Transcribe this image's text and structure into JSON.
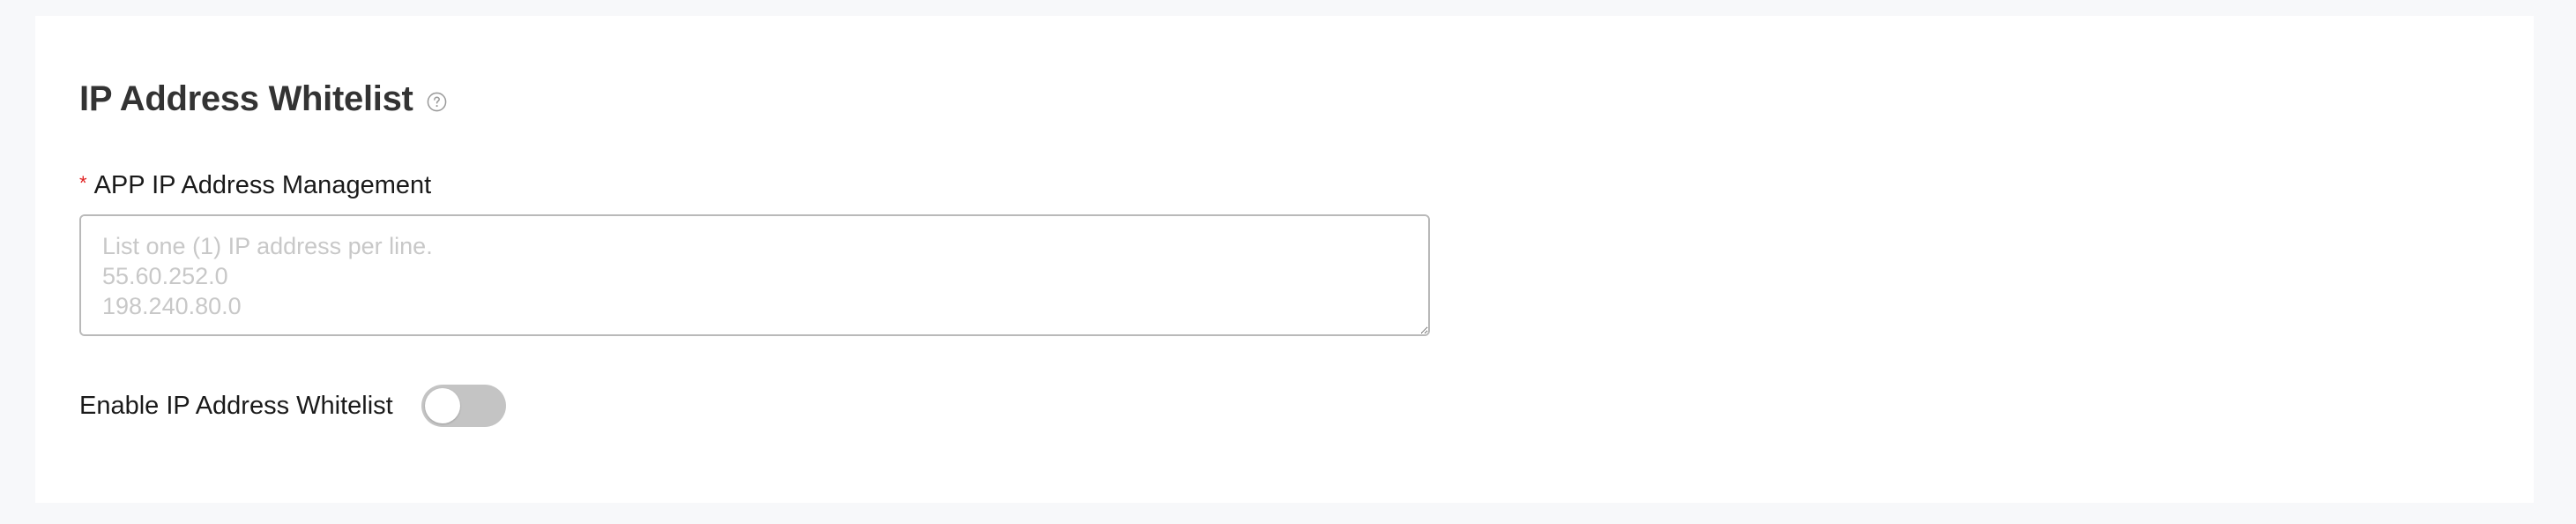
{
  "section": {
    "title": "IP Address Whitelist",
    "help_icon": "question-circle-icon"
  },
  "ip_management": {
    "required_marker": "*",
    "label": "APP IP Address Management",
    "value": "",
    "placeholder": "List one (1) IP address per line.\n55.60.252.0\n198.240.80.0"
  },
  "whitelist_toggle": {
    "label": "Enable IP Address Whitelist",
    "enabled": false
  },
  "colors": {
    "required": "#e02020",
    "toggle_off": "#c4c4c4",
    "page_background": "#f7f8fa",
    "card_background": "#ffffff"
  }
}
